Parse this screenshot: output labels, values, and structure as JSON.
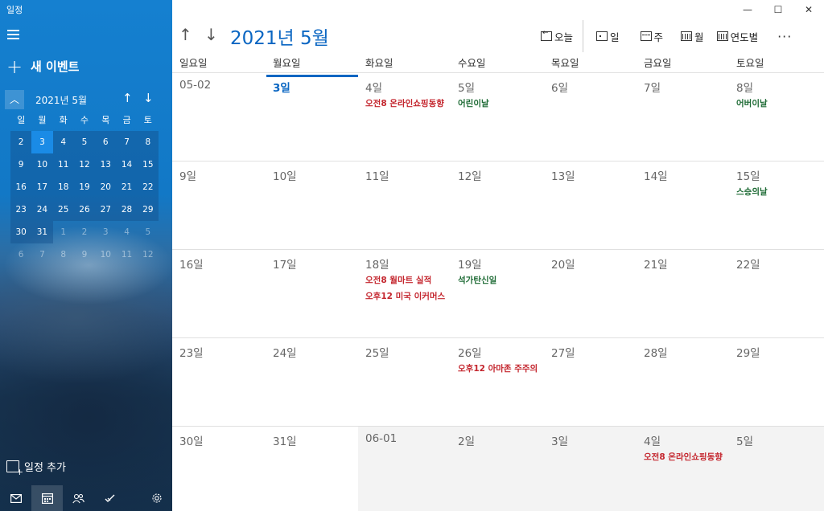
{
  "app": {
    "title": "일정"
  },
  "sidebar": {
    "new_event_label": "새 이벤트",
    "add_calendar_label": "일정 추가",
    "mini": {
      "title": "2021년 5월",
      "weekdays": [
        "일",
        "월",
        "화",
        "수",
        "목",
        "금",
        "토"
      ],
      "days": [
        [
          {
            "d": "2",
            "out": false
          },
          {
            "d": "3",
            "out": false,
            "today": true
          },
          {
            "d": "4",
            "out": false
          },
          {
            "d": "5",
            "out": false
          },
          {
            "d": "6",
            "out": false
          },
          {
            "d": "7",
            "out": false
          },
          {
            "d": "8",
            "out": false
          }
        ],
        [
          {
            "d": "9",
            "out": false
          },
          {
            "d": "10",
            "out": false
          },
          {
            "d": "11",
            "out": false
          },
          {
            "d": "12",
            "out": false
          },
          {
            "d": "13",
            "out": false
          },
          {
            "d": "14",
            "out": false
          },
          {
            "d": "15",
            "out": false
          }
        ],
        [
          {
            "d": "16",
            "out": false
          },
          {
            "d": "17",
            "out": false
          },
          {
            "d": "18",
            "out": false
          },
          {
            "d": "19",
            "out": false
          },
          {
            "d": "20",
            "out": false
          },
          {
            "d": "21",
            "out": false
          },
          {
            "d": "22",
            "out": false
          }
        ],
        [
          {
            "d": "23",
            "out": false
          },
          {
            "d": "24",
            "out": false
          },
          {
            "d": "25",
            "out": false
          },
          {
            "d": "26",
            "out": false
          },
          {
            "d": "27",
            "out": false
          },
          {
            "d": "28",
            "out": false
          },
          {
            "d": "29",
            "out": false
          }
        ],
        [
          {
            "d": "30",
            "out": false
          },
          {
            "d": "31",
            "out": false
          },
          {
            "d": "1",
            "out": true
          },
          {
            "d": "2",
            "out": true
          },
          {
            "d": "3",
            "out": true
          },
          {
            "d": "4",
            "out": true
          },
          {
            "d": "5",
            "out": true
          }
        ],
        [
          {
            "d": "6",
            "out": true
          },
          {
            "d": "7",
            "out": true
          },
          {
            "d": "8",
            "out": true
          },
          {
            "d": "9",
            "out": true
          },
          {
            "d": "10",
            "out": true
          },
          {
            "d": "11",
            "out": true
          },
          {
            "d": "12",
            "out": true
          }
        ]
      ]
    },
    "bottom_icons": [
      "mail-icon",
      "calendar-icon",
      "people-icon",
      "todo-icon",
      "settings-icon"
    ]
  },
  "header": {
    "month_title": "2021년 5월",
    "toolbar": {
      "today": "오늘",
      "day": "일",
      "week": "주",
      "month": "월",
      "year": "연도별",
      "more": "···"
    }
  },
  "weekdays": [
    "일요일",
    "월요일",
    "화요일",
    "수요일",
    "목요일",
    "금요일",
    "토요일"
  ],
  "colors": {
    "accent": "#0a66c2",
    "event_red": "#c4262e",
    "event_green": "#1e6b35"
  },
  "weeks": [
    [
      {
        "label": "05-02",
        "events": []
      },
      {
        "label": "3일",
        "today": true,
        "events": []
      },
      {
        "label": "4일",
        "events": [
          {
            "text": "오전8 온라인쇼핑동향",
            "color": "red"
          }
        ]
      },
      {
        "label": "5일",
        "events": [
          {
            "text": "어린이날",
            "color": "green"
          }
        ]
      },
      {
        "label": "6일",
        "events": []
      },
      {
        "label": "7일",
        "events": []
      },
      {
        "label": "8일",
        "events": [
          {
            "text": "어버이날",
            "color": "green"
          }
        ]
      }
    ],
    [
      {
        "label": "9일",
        "events": []
      },
      {
        "label": "10일",
        "events": []
      },
      {
        "label": "11일",
        "events": []
      },
      {
        "label": "12일",
        "events": []
      },
      {
        "label": "13일",
        "events": []
      },
      {
        "label": "14일",
        "events": []
      },
      {
        "label": "15일",
        "events": [
          {
            "text": "스승의날",
            "color": "green"
          }
        ]
      }
    ],
    [
      {
        "label": "16일",
        "events": []
      },
      {
        "label": "17일",
        "events": []
      },
      {
        "label": "18일",
        "events": [
          {
            "text": "오전8 월마트 실적",
            "color": "red"
          },
          {
            "text": "오후12 미국 이커머스",
            "color": "red"
          }
        ]
      },
      {
        "label": "19일",
        "events": [
          {
            "text": "석가탄신일",
            "color": "green"
          }
        ]
      },
      {
        "label": "20일",
        "events": []
      },
      {
        "label": "21일",
        "events": []
      },
      {
        "label": "22일",
        "events": []
      }
    ],
    [
      {
        "label": "23일",
        "events": []
      },
      {
        "label": "24일",
        "events": []
      },
      {
        "label": "25일",
        "events": []
      },
      {
        "label": "26일",
        "events": [
          {
            "text": "오후12 아마존 주주의",
            "color": "red"
          }
        ]
      },
      {
        "label": "27일",
        "events": []
      },
      {
        "label": "28일",
        "events": []
      },
      {
        "label": "29일",
        "events": []
      }
    ],
    [
      {
        "label": "30일",
        "events": []
      },
      {
        "label": "31일",
        "events": []
      },
      {
        "label": "06-01",
        "next": true,
        "events": []
      },
      {
        "label": "2일",
        "next": true,
        "events": []
      },
      {
        "label": "3일",
        "next": true,
        "events": []
      },
      {
        "label": "4일",
        "next": true,
        "events": [
          {
            "text": "오전8 온라인쇼핑동향",
            "color": "red"
          }
        ]
      },
      {
        "label": "5일",
        "next": true,
        "events": []
      }
    ]
  ]
}
